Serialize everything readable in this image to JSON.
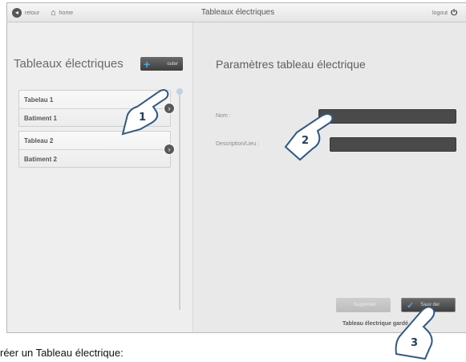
{
  "topbar": {
    "back_label": "retour",
    "home_label": "home",
    "title": "Tableaux électriques",
    "logout_label": "logout"
  },
  "left": {
    "title": "Tableaux électriques",
    "add_label": "outer",
    "items": [
      {
        "name": "Tabelau 1",
        "location": "Batiment 1"
      },
      {
        "name": "Tableau 2",
        "location": "Batiment 2"
      }
    ]
  },
  "form": {
    "title": "Paramètres tableau électrique",
    "name_label": "Nom :",
    "name_value": "",
    "desc_label": "Description/Lieu :",
    "desc_value": ""
  },
  "actions": {
    "delete_label": "Supprimer",
    "save_label": "Sauv der",
    "status": "Tableau électrique  gardé"
  },
  "callouts": [
    "1",
    "2",
    "3"
  ],
  "caption": "réer un Tableau électrique:",
  "colors": {
    "accent": "#49a9e6",
    "dark_field": "#4a4a4a"
  }
}
